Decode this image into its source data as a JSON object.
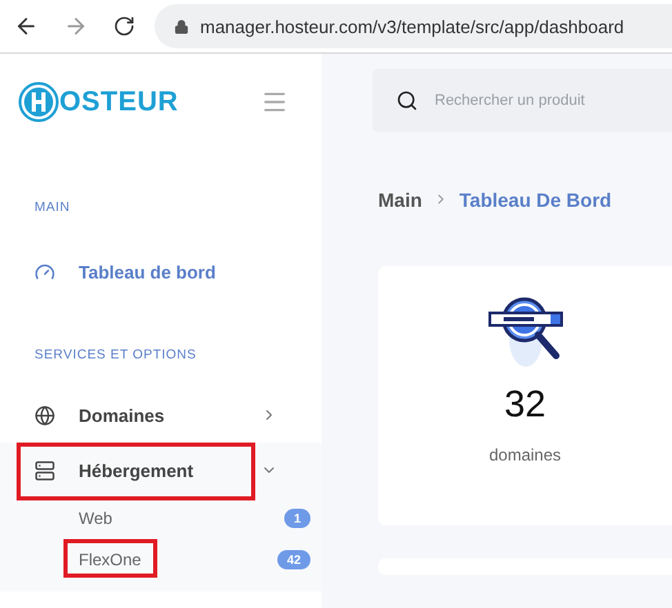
{
  "browser": {
    "url": "manager.hosteur.com/v3/template/src/app/dashboard"
  },
  "sidebar": {
    "logo": "OSTEUR",
    "sections": [
      {
        "title": "MAIN",
        "items": [
          {
            "label": "Tableau de bord",
            "selected": true,
            "highlighted": false
          }
        ]
      },
      {
        "title": "SERVICES ET OPTIONS",
        "items": [
          {
            "label": "Domaines",
            "selected": false,
            "highlighted": false,
            "expanded": false
          },
          {
            "label": "Hébergement",
            "selected": false,
            "highlighted": true,
            "expanded": true,
            "children": [
              {
                "label": "Web",
                "badge": "1",
                "highlighted": false
              },
              {
                "label": "FlexOne",
                "badge": "42",
                "highlighted": true
              }
            ]
          }
        ]
      }
    ]
  },
  "search": {
    "placeholder": "Rechercher un produit"
  },
  "breadcrumb": [
    {
      "label": "Main",
      "selected": false
    },
    {
      "label": "Tableau De Bord",
      "selected": true
    }
  ],
  "cards": [
    {
      "value": "32",
      "label": "domaines"
    }
  ]
}
